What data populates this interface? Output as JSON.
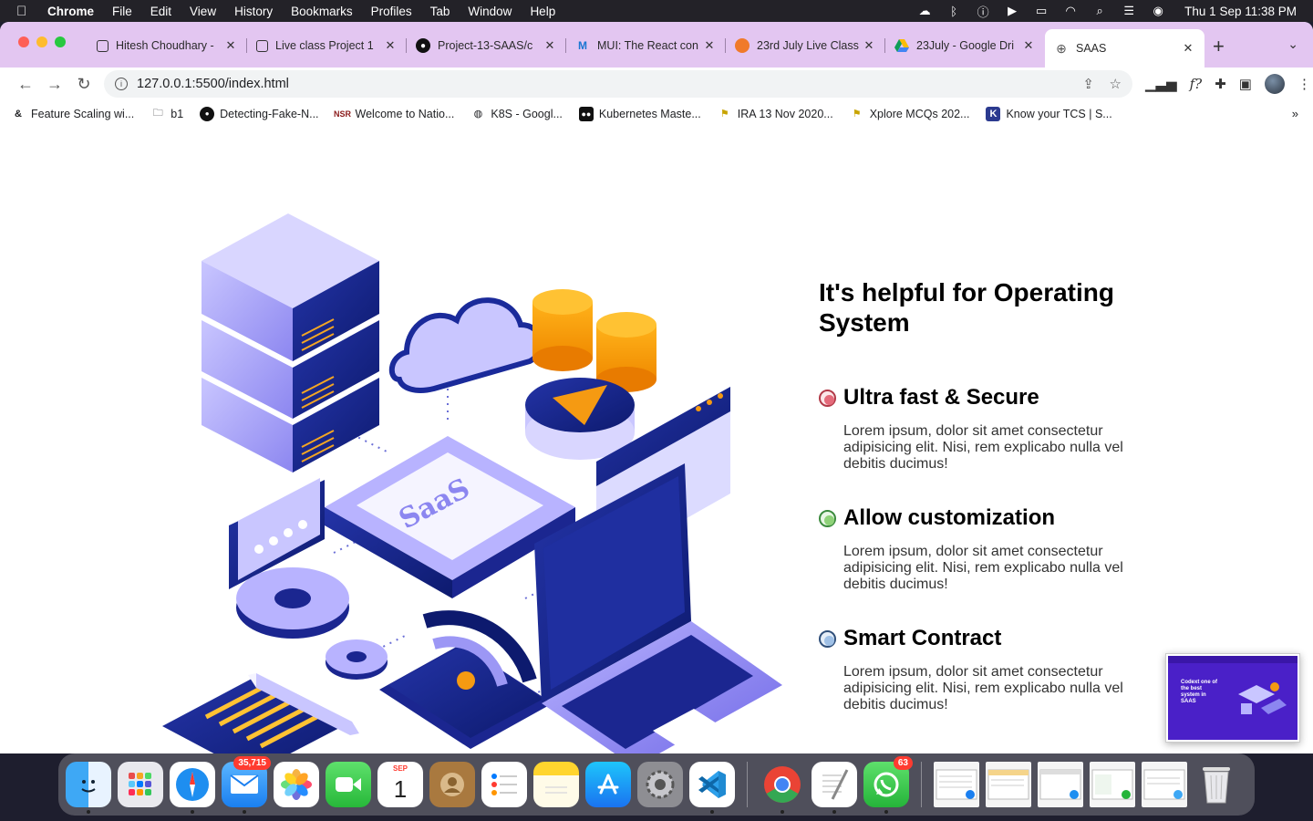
{
  "menubar": {
    "app": "Chrome",
    "items": [
      "File",
      "Edit",
      "View",
      "History",
      "Bookmarks",
      "Profiles",
      "Tab",
      "Window",
      "Help"
    ],
    "clock": "Thu 1 Sep  11:38 PM"
  },
  "tabs": [
    {
      "title": "Hitesh Choudhary -",
      "icon": "square-icon"
    },
    {
      "title": "Live class Project 1",
      "icon": "square-icon"
    },
    {
      "title": "Project-13-SAAS/c",
      "icon": "github-icon"
    },
    {
      "title": "MUI: The React con",
      "icon": "mui-icon"
    },
    {
      "title": "23rd July Live Class",
      "icon": "orange-circle-icon"
    },
    {
      "title": "23July - Google Dri",
      "icon": "google-drive-icon"
    },
    {
      "title": "SAAS",
      "icon": "globe-icon",
      "active": true
    }
  ],
  "address": {
    "url": "127.0.0.1:5500/index.html"
  },
  "bookmarks": [
    {
      "label": "Feature Scaling wi..."
    },
    {
      "label": "b1"
    },
    {
      "label": "Detecting-Fake-N..."
    },
    {
      "label": "Welcome to Natio..."
    },
    {
      "label": "K8S - Googl..."
    },
    {
      "label": "Kubernetes Maste..."
    },
    {
      "label": "IRA 13 Nov 2020..."
    },
    {
      "label": "Xplore MCQs 202..."
    },
    {
      "label": "Know your TCS | S..."
    }
  ],
  "page": {
    "heading": "It's helpful for Operating System",
    "illustration_label": "SaaS",
    "features": [
      {
        "title": "Ultra fast & Secure",
        "desc": "Lorem ipsum, dolor sit amet consectetur adipisicing elit. Nisi, rem explicabo nulla vel debitis ducimus!",
        "bullet_color": "#e46a7a"
      },
      {
        "title": "Allow customization",
        "desc": "Lorem ipsum, dolor sit amet consectetur adipisicing elit. Nisi, rem explicabo nulla vel debitis ducimus!",
        "bullet_color": "#8ed178"
      },
      {
        "title": "Smart Contract",
        "desc": "Lorem ipsum, dolor sit amet consectetur adipisicing elit. Nisi, rem explicabo nulla vel debitis ducimus!",
        "bullet_color": "#9fc0e6"
      }
    ]
  },
  "thumbnail": {
    "text": "Codext one of the best system in SAAS"
  },
  "dock": {
    "mail_badge": "35,715",
    "whatsapp_badge": "63",
    "calendar_month": "SEP",
    "calendar_day": "1"
  }
}
